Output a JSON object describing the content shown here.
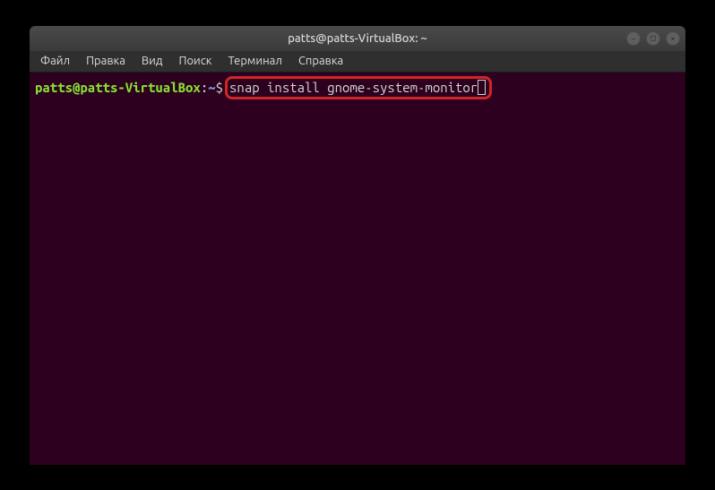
{
  "window": {
    "title": "patts@patts-VirtualBox: ~"
  },
  "menubar": {
    "items": [
      "Файл",
      "Правка",
      "Вид",
      "Поиск",
      "Терминал",
      "Справка"
    ]
  },
  "terminal": {
    "prompt_user_host": "patts@patts-VirtualBox",
    "prompt_colon": ":",
    "prompt_path": "~",
    "prompt_symbol": "$",
    "command": "snap install gnome-system-monitor"
  },
  "controls": {
    "minimize": "−",
    "maximize": "□",
    "close": "×"
  }
}
